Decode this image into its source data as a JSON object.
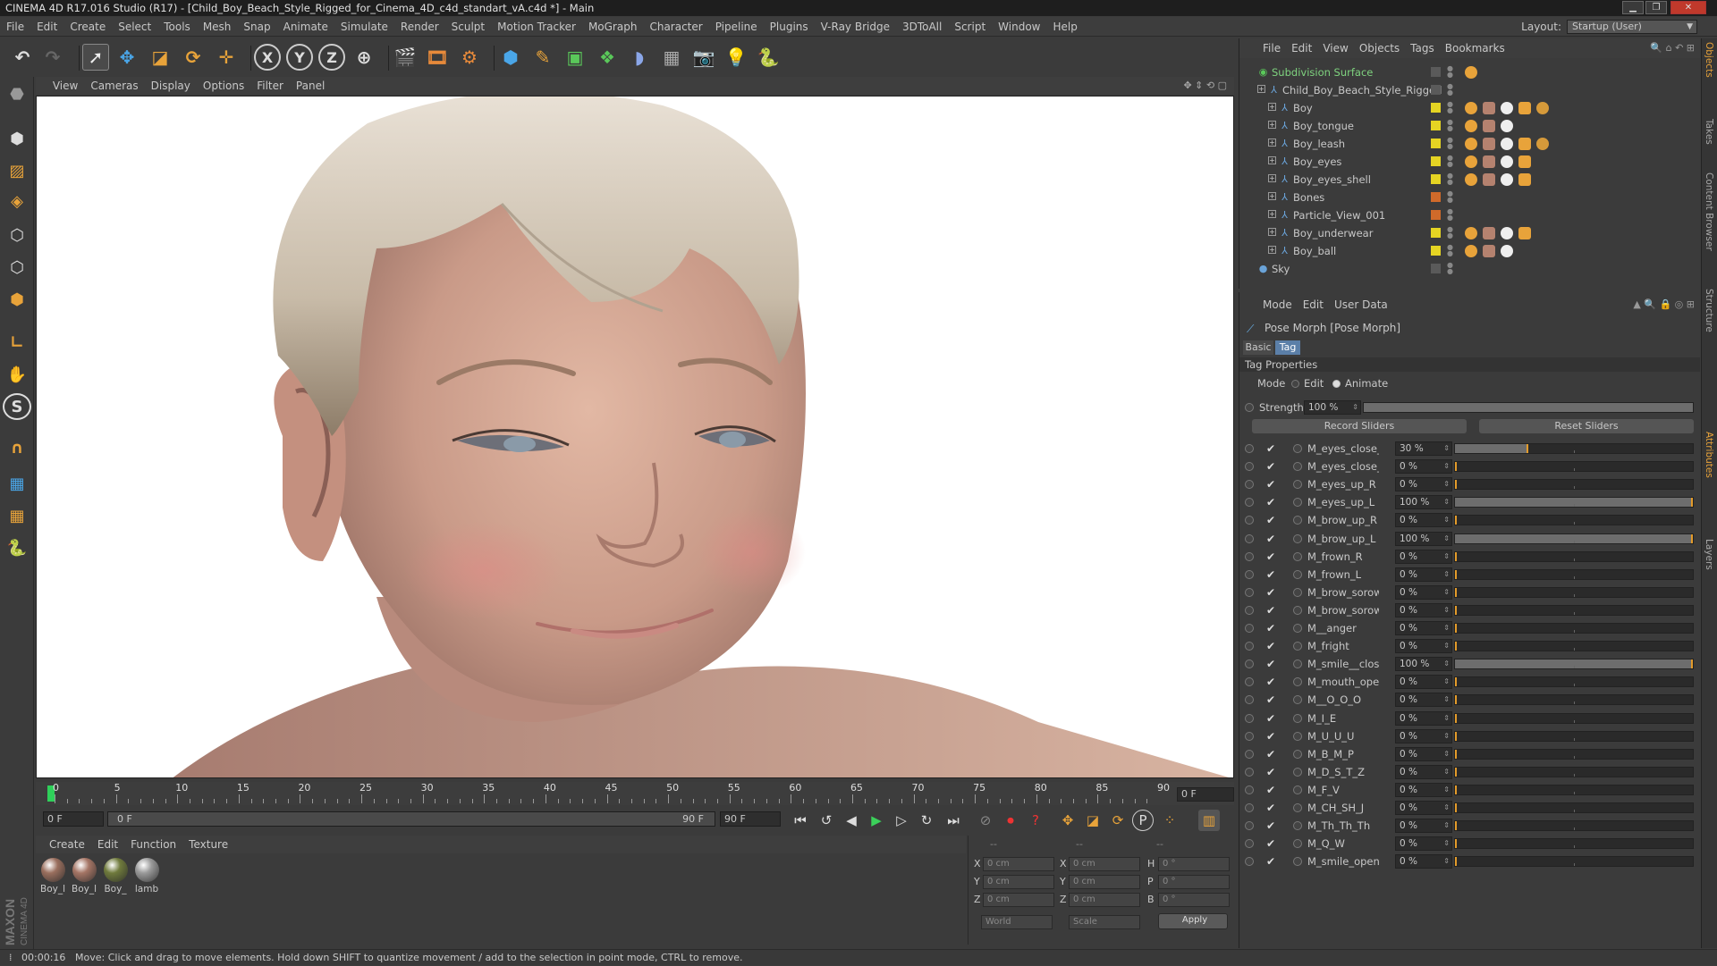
{
  "window": {
    "title": "CINEMA 4D R17.016 Studio (R17) - [Child_Boy_Beach_Style_Rigged_for_Cinema_4D_c4d_standart_vA.c4d *] - Main"
  },
  "menubar": {
    "items": [
      "File",
      "Edit",
      "Create",
      "Select",
      "Tools",
      "Mesh",
      "Snap",
      "Animate",
      "Simulate",
      "Render",
      "Sculpt",
      "Motion Tracker",
      "MoGraph",
      "Character",
      "Pipeline",
      "Plugins",
      "V-Ray Bridge",
      "3DToAll",
      "Script",
      "Window",
      "Help"
    ],
    "layout_label": "Layout:",
    "layout_value": "Startup (User)"
  },
  "viewport": {
    "menu": [
      "View",
      "Cameras",
      "Display",
      "Options",
      "Filter",
      "Panel"
    ]
  },
  "timeline": {
    "ticks": [
      "0",
      "5",
      "10",
      "15",
      "20",
      "25",
      "30",
      "35",
      "40",
      "45",
      "50",
      "55",
      "60",
      "65",
      "70",
      "75",
      "80",
      "85",
      "90"
    ],
    "current_frame": "0 F",
    "start_field": "0 F",
    "range_start": "0 F",
    "range_end": "90 F",
    "end_field": "90 F"
  },
  "material_manager": {
    "menu": [
      "Create",
      "Edit",
      "Function",
      "Texture"
    ],
    "materials": [
      {
        "label": "Boy_l",
        "color": "#9a6f5e"
      },
      {
        "label": "Boy_l",
        "color": "#a57565"
      },
      {
        "label": "Boy_",
        "color": "#6f7a3c"
      },
      {
        "label": "lamb",
        "color": "#9a9a9a"
      }
    ]
  },
  "coordinates": {
    "header": [
      "--",
      "--",
      "--"
    ],
    "rows": [
      {
        "a": "X",
        "av": "0 cm",
        "b": "X",
        "bv": "0 cm",
        "c": "H",
        "cv": "0 °"
      },
      {
        "a": "Y",
        "av": "0 cm",
        "b": "Y",
        "bv": "0 cm",
        "c": "P",
        "cv": "0 °"
      },
      {
        "a": "Z",
        "av": "0 cm",
        "b": "Z",
        "bv": "0 cm",
        "c": "B",
        "cv": "0 °"
      }
    ],
    "space": "World",
    "mode": "Scale",
    "apply": "Apply"
  },
  "status": {
    "time": "00:00:16",
    "message": "Move: Click and drag to move elements. Hold down SHIFT to quantize movement / add to the selection in point mode, CTRL to remove."
  },
  "branding": {
    "maxon": "MAXON",
    "c4d": "CINEMA 4D"
  },
  "object_manager": {
    "menu": [
      "File",
      "Edit",
      "View",
      "Objects",
      "Tags",
      "Bookmarks"
    ],
    "objects": [
      {
        "name": "Subdivision Surface",
        "depth": 0,
        "layer": "#5a5a5a",
        "tags": 1
      },
      {
        "name": "Child_Boy_Beach_Style_Rigged",
        "depth": 1,
        "layer": "#5a5a5a",
        "tags": 0
      },
      {
        "name": "Boy",
        "depth": 2,
        "layer": "#e5d423",
        "tags": 5
      },
      {
        "name": "Boy_tongue",
        "depth": 2,
        "layer": "#e5d423",
        "tags": 3
      },
      {
        "name": "Boy_leash",
        "depth": 2,
        "layer": "#e5d423",
        "tags": 5
      },
      {
        "name": "Boy_eyes",
        "depth": 2,
        "layer": "#e5d423",
        "tags": 4
      },
      {
        "name": "Boy_eyes_shell",
        "depth": 2,
        "layer": "#e5d423",
        "tags": 4
      },
      {
        "name": "Bones",
        "depth": 2,
        "layer": "#d06a2a",
        "tags": 0
      },
      {
        "name": "Particle_View_001",
        "depth": 2,
        "layer": "#d06a2a",
        "tags": 0
      },
      {
        "name": "Boy_underwear",
        "depth": 2,
        "layer": "#e5d423",
        "tags": 4
      },
      {
        "name": "Boy_ball",
        "depth": 2,
        "layer": "#e5d423",
        "tags": 3
      },
      {
        "name": "Sky",
        "depth": 0,
        "layer": "#5a5a5a",
        "tags": 0
      }
    ]
  },
  "side_tabs": [
    "Objects",
    "Takes",
    "Content Browser",
    "Structure",
    "Attributes",
    "Layers"
  ],
  "attributes": {
    "menu": [
      "Mode",
      "Edit",
      "User Data"
    ],
    "title": "Pose Morph [Pose Morph]",
    "tabs": [
      "Basic",
      "Tag"
    ],
    "section": "Tag Properties",
    "mode_label": "Mode",
    "mode_options": [
      "Edit",
      "Animate"
    ],
    "strength_label": "Strength",
    "strength_value": "100 %",
    "strength_fraction": 1.0,
    "record_sliders": "Record Sliders",
    "reset_sliders": "Reset Sliders",
    "morphs": [
      {
        "name": "M_eyes_close_R",
        "value": "30 %",
        "fraction": 0.3
      },
      {
        "name": "M_eyes_close_L",
        "value": "0 %",
        "fraction": 0
      },
      {
        "name": "M_eyes_up_R",
        "value": "0 %",
        "fraction": 0
      },
      {
        "name": "M_eyes_up_L",
        "value": "100 %",
        "fraction": 1.0
      },
      {
        "name": "M_brow_up_R",
        "value": "0 %",
        "fraction": 0
      },
      {
        "name": "M_brow_up_L",
        "value": "100 %",
        "fraction": 1.0
      },
      {
        "name": "M_frown_R",
        "value": "0 %",
        "fraction": 0
      },
      {
        "name": "M_frown_L",
        "value": "0 %",
        "fraction": 0
      },
      {
        "name": "M_brow_sorow_R",
        "value": "0 %",
        "fraction": 0
      },
      {
        "name": "M_brow_sorow_L",
        "value": "0 %",
        "fraction": 0
      },
      {
        "name": "M__anger",
        "value": "0 %",
        "fraction": 0
      },
      {
        "name": "M_fright",
        "value": "0 %",
        "fraction": 0
      },
      {
        "name": "M_smile__close",
        "value": "100 %",
        "fraction": 1.0
      },
      {
        "name": "M_mouth_open",
        "value": "0 %",
        "fraction": 0
      },
      {
        "name": "M__O_O_O",
        "value": "0 %",
        "fraction": 0
      },
      {
        "name": "M_I_E",
        "value": "0 %",
        "fraction": 0
      },
      {
        "name": "M_U_U_U",
        "value": "0 %",
        "fraction": 0
      },
      {
        "name": "M_B_M_P",
        "value": "0 %",
        "fraction": 0
      },
      {
        "name": "M_D_S_T_Z",
        "value": "0 %",
        "fraction": 0
      },
      {
        "name": "M_F_V",
        "value": "0 %",
        "fraction": 0
      },
      {
        "name": "M_CH_SH_J",
        "value": "0 %",
        "fraction": 0
      },
      {
        "name": "M_Th_Th_Th",
        "value": "0 %",
        "fraction": 0
      },
      {
        "name": "M_Q_W",
        "value": "0 %",
        "fraction": 0
      },
      {
        "name": "M_smile_open",
        "value": "0 %",
        "fraction": 0
      }
    ]
  }
}
